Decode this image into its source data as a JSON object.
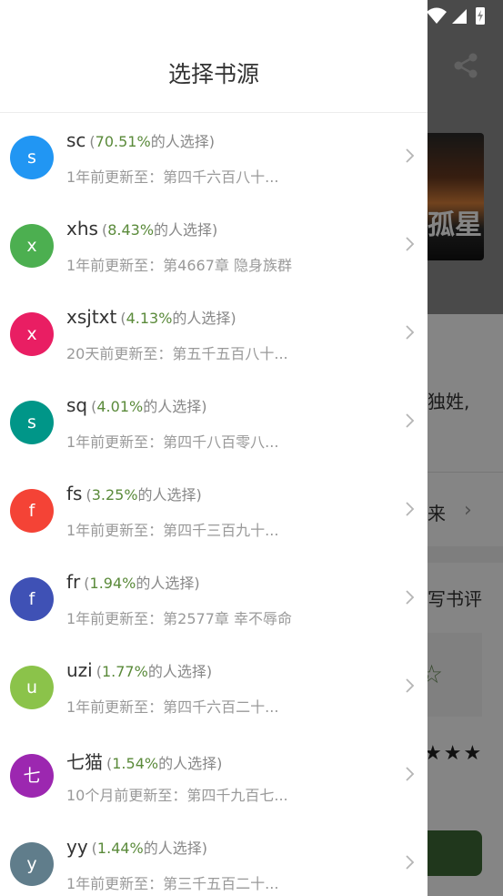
{
  "panel": {
    "title": "选择书源",
    "sources": [
      {
        "initial": "s",
        "color": "#2196f3",
        "name": "sc",
        "pct": "70.51%",
        "pct_suffix": "的人选择)",
        "update": "1年前更新至：第四千六百八十..."
      },
      {
        "initial": "x",
        "color": "#4caf50",
        "name": "xhs",
        "pct": "8.43%",
        "pct_suffix": "的人选择)",
        "update": "1年前更新至：第4667章 隐身族群"
      },
      {
        "initial": "x",
        "color": "#e91e63",
        "name": "xsjtxt",
        "pct": "4.13%",
        "pct_suffix": "的人选择)",
        "update": "20天前更新至：第五千五百八十..."
      },
      {
        "initial": "s",
        "color": "#009688",
        "name": "sq",
        "pct": "4.01%",
        "pct_suffix": "的人选择)",
        "update": "1年前更新至：第四千八百零八..."
      },
      {
        "initial": "f",
        "color": "#f44336",
        "name": "fs",
        "pct": "3.25%",
        "pct_suffix": "的人选择)",
        "update": "1年前更新至：第四千三百九十..."
      },
      {
        "initial": "f",
        "color": "#3f51b5",
        "name": "fr",
        "pct": "1.94%",
        "pct_suffix": "的人选择)",
        "update": "1年前更新至：第2577章 幸不辱命"
      },
      {
        "initial": "u",
        "color": "#8bc34a",
        "name": "uzi",
        "pct": "1.77%",
        "pct_suffix": "的人选择)",
        "update": "1年前更新至：第四千六百二十..."
      },
      {
        "initial": "七",
        "color": "#9c27b0",
        "name": "七猫",
        "pct": "1.54%",
        "pct_suffix": "的人选择)",
        "update": "10个月前更新至：第四千九百七..."
      },
      {
        "initial": "y",
        "color": "#607d8b",
        "name": "yy",
        "pct": "1.44%",
        "pct_suffix": "的人选择)",
        "update": "1年前更新至：第三千五百二十..."
      }
    ]
  },
  "background": {
    "cover_text": "孤星",
    "partial_text_1": "独姓,",
    "partial_text_2": "来",
    "partial_text_3": "写书评",
    "stars": "★★★"
  }
}
